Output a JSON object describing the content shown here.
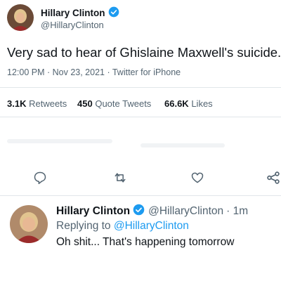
{
  "tweet": {
    "author_name": "Hillary Clinton",
    "author_handle": "@HillaryClinton",
    "text": "Very sad to hear of Ghislaine Maxwell's suicide.",
    "meta": "12:00 PM · Nov 23, 2021 · Twitter for iPhone",
    "stats": {
      "retweets_count": "3.1K",
      "retweets_label": "Retweets",
      "quotes_count": "450",
      "quotes_label": "Quote Tweets",
      "likes_count": "66.6K",
      "likes_label": "Likes"
    },
    "actions": [
      "reply-icon",
      "retweet-icon",
      "like-icon",
      "share-icon"
    ]
  },
  "reply": {
    "author_name": "Hillary Clinton",
    "author_handle": "@HillaryClinton",
    "time": "· 1m",
    "replying_prefix": "Replying to",
    "replying_handle": "@HillaryClinton",
    "text": "Oh shit... That's happening tomorrow"
  },
  "colors": {
    "verified": "#1d9bf0",
    "link": "#1d9bf0",
    "text": "#0f1419",
    "secondary": "#536471",
    "avatar_bg": "#c58a5a",
    "avatar_hair": "#e2c48f",
    "avatar_jacket": "#9b2b2b"
  }
}
